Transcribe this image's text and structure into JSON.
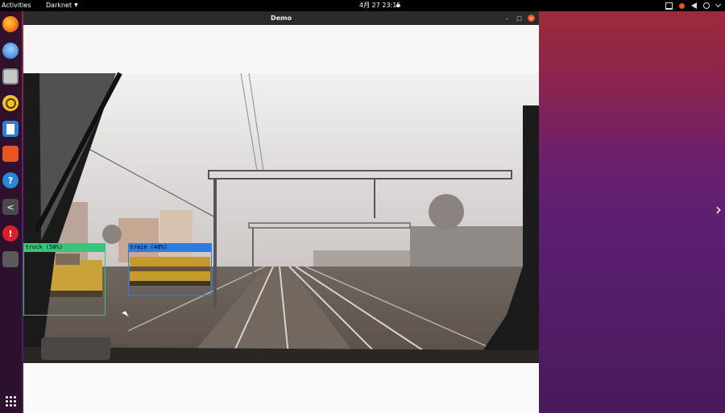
{
  "topbar": {
    "activities": "Activities",
    "app_menu": "Darknet",
    "clock": "4月 27  23:15"
  },
  "dock": {
    "items": [
      "firefox-icon",
      "thunderbird-icon",
      "files-icon",
      "rhythmbox-icon",
      "writer-icon",
      "software-icon",
      "help-icon",
      "terminal-icon",
      "error-icon",
      "window-icon",
      "apps-grid-icon"
    ],
    "help_glyph": "?",
    "term_glyph": "<",
    "err_glyph": "!"
  },
  "window": {
    "title": "Demo",
    "min_glyph": "–",
    "max_glyph": "□",
    "close_glyph": "×"
  },
  "detections": [
    {
      "label": "truck (58%)",
      "class": "truck",
      "confidence": 58,
      "color": "#39c47d"
    },
    {
      "label": "train (48%)",
      "class": "train",
      "confidence": 48,
      "color": "#2a7de1"
    }
  ],
  "desktop": {
    "arrow": "›"
  },
  "colors": {
    "accent": "#e95420",
    "truck": "#39c47d",
    "train": "#2a7de1"
  }
}
